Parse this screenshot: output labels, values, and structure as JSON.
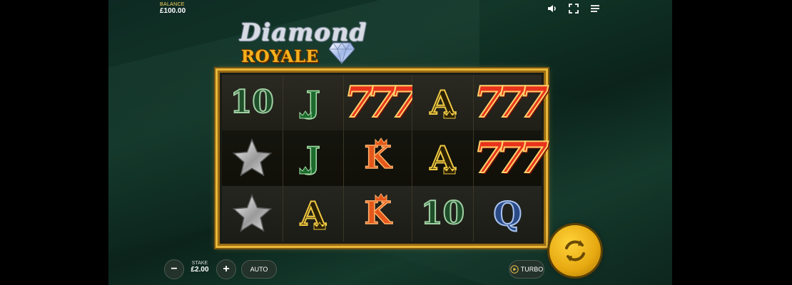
{
  "header": {
    "balance_label": "BALANCE",
    "balance_value": "£100.00",
    "icons": [
      "speaker-icon",
      "fullscreen-icon",
      "menu-icon"
    ]
  },
  "logo": {
    "line1": "Diamond",
    "line2": "ROYALE"
  },
  "reels": {
    "rows": [
      [
        "10",
        "J",
        "777",
        "A",
        "777"
      ],
      [
        "star",
        "J",
        "K",
        "A",
        "777"
      ],
      [
        "star",
        "A",
        "K",
        "10",
        "Q"
      ]
    ]
  },
  "controls": {
    "minus_label": "−",
    "stake_label": "STAKE",
    "stake_value": "£2.00",
    "plus_label": "+",
    "auto_label": "AUTO",
    "turbo_label": "TURBO",
    "spin_icon": "spin-arrows-icon"
  },
  "colors": {
    "gold": "#e8b73a",
    "background": "#123629",
    "spin_button": "#e6a810"
  }
}
